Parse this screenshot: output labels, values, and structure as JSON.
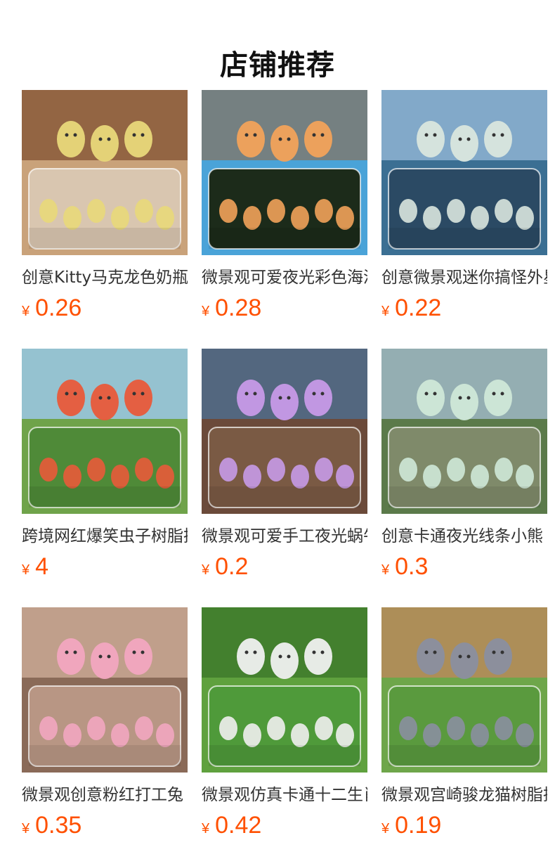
{
  "section": {
    "title": "店铺推荐"
  },
  "products": [
    {
      "name": "创意Kitty马克龙色奶瓶",
      "currency": "¥",
      "price": "0.26",
      "image": "pastel-baby-bottles-on-wooden-table",
      "palette": {
        "bg": "#c9a27a",
        "top": "#8a5a3a",
        "accent": "#e8d87a",
        "panel": "#d9c6b0"
      }
    },
    {
      "name": "微景观可爱夜光彩色海洋",
      "currency": "¥",
      "price": "0.28",
      "image": "glowing-sea-creatures-on-blue-sand",
      "palette": {
        "bg": "#4aa3d8",
        "top": "#7d7a72",
        "accent": "#f2a25a",
        "panel": "#1c2b1a"
      }
    },
    {
      "name": "创意微景观迷你搞怪外星人",
      "currency": "¥",
      "price": "0.22",
      "image": "glowing-aliens-on-rock-by-sea",
      "palette": {
        "bg": "#3b6f93",
        "top": "#8fb4d2",
        "accent": "#d9e6de",
        "panel": "#2b4a64"
      }
    },
    {
      "name": "跨境网红爆笑虫子树脂摆件",
      "currency": "¥",
      "price": "4",
      "image": "cartoon-larva-figures-on-grass",
      "palette": {
        "bg": "#6fa34a",
        "top": "#9cc8e8",
        "accent": "#e85a3a",
        "panel": "#4f8a38"
      }
    },
    {
      "name": "微景观可爱手工夜光蜗牛",
      "currency": "¥",
      "price": "0.2",
      "image": "translucent-snail-figures-on-log",
      "palette": {
        "bg": "#6b4a3a",
        "top": "#4f6c8c",
        "accent": "#c79ae8",
        "panel": "#7a5a44"
      }
    },
    {
      "name": "创意卡通夜光线条小熊",
      "currency": "¥",
      "price": "0.3",
      "image": "glowing-bear-figures-in-forest",
      "palette": {
        "bg": "#5b7a4a",
        "top": "#9fb7c4",
        "accent": "#cfe8d8",
        "panel": "#7f8a6a"
      }
    },
    {
      "name": "微景观创意粉红打工兔",
      "currency": "¥",
      "price": "0.35",
      "image": "pink-rabbit-figures-with-furniture",
      "palette": {
        "bg": "#8a6a58",
        "top": "#c9a894",
        "accent": "#f2a6c0",
        "panel": "#b89684"
      }
    },
    {
      "name": "微景观仿真卡通十二生肖",
      "currency": "¥",
      "price": "0.42",
      "image": "cartoon-zodiac-animals-on-lawn",
      "palette": {
        "bg": "#5fa13e",
        "top": "#3e7a2c",
        "accent": "#f0f0f0",
        "panel": "#4f9a3a"
      }
    },
    {
      "name": "微景观宫崎骏龙猫树脂摆件",
      "currency": "¥",
      "price": "0.19",
      "image": "totoro-figures-on-green-lawn",
      "palette": {
        "bg": "#6ea64a",
        "top": "#b88a5a",
        "accent": "#8a8fa0",
        "panel": "#5a9a3e"
      }
    }
  ]
}
